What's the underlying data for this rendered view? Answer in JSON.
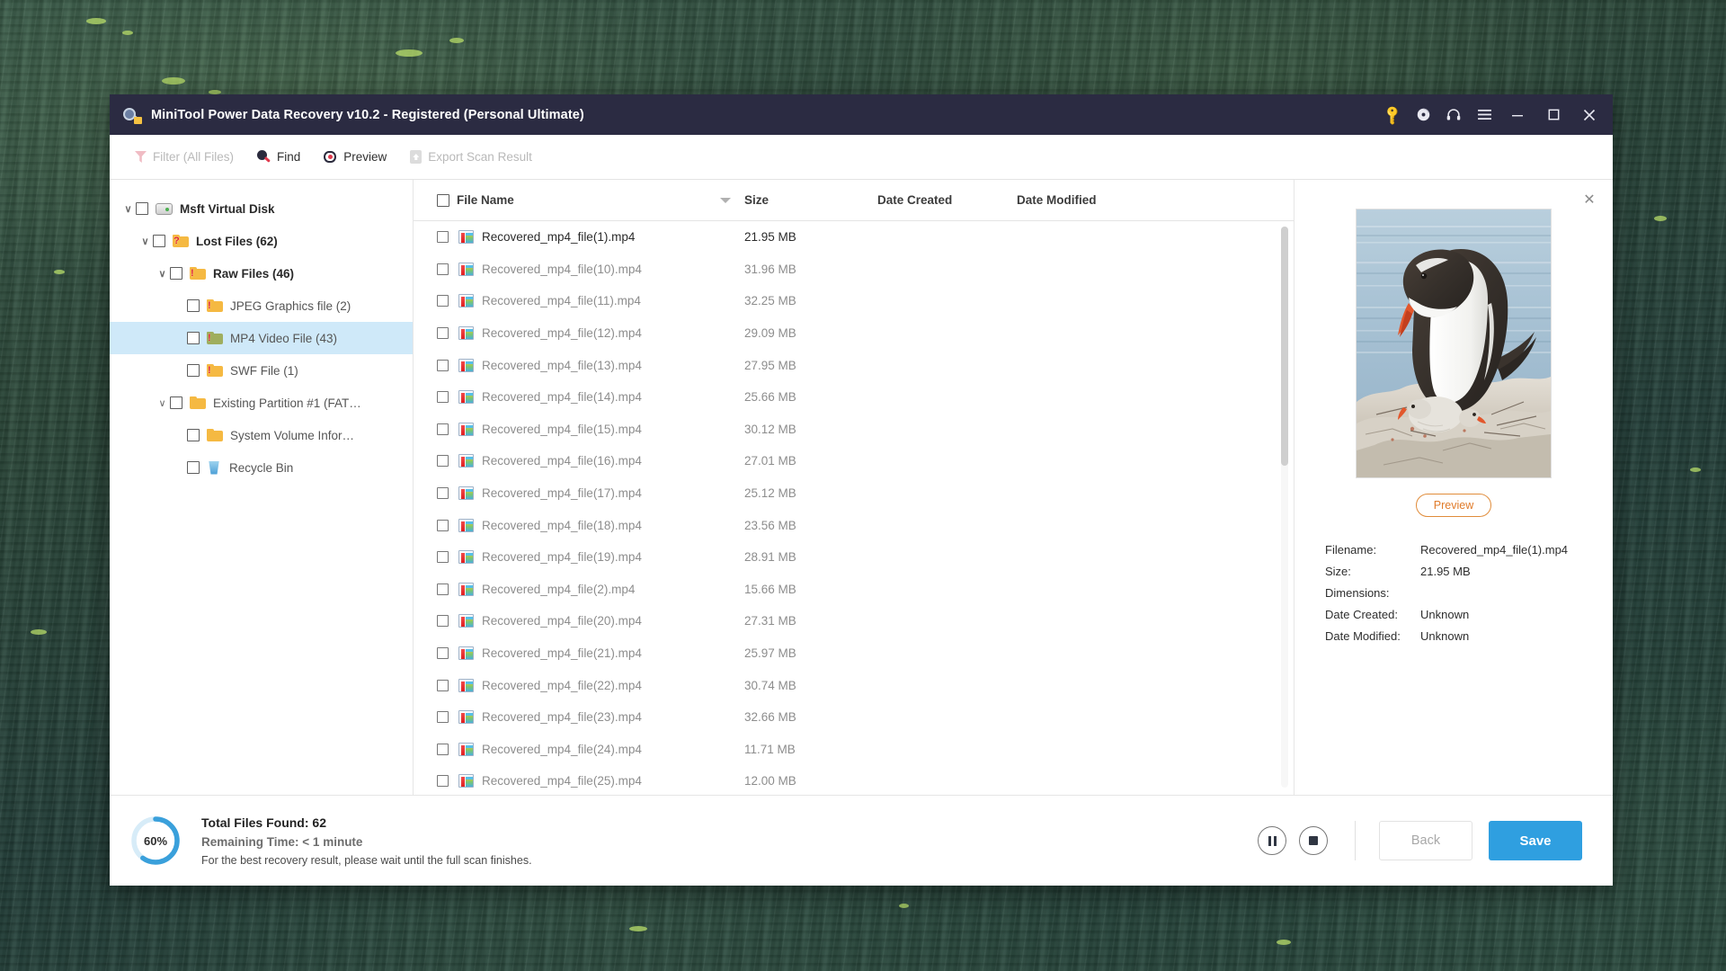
{
  "window": {
    "title": "MiniTool Power Data Recovery v10.2 - Registered (Personal Ultimate)",
    "icons": {
      "key": "key-icon",
      "disc": "disc-icon",
      "headset": "headset-icon",
      "menu": "hamburger-menu-icon",
      "minimize": "minimize-icon",
      "maximize": "maximize-icon",
      "close": "close-icon"
    },
    "controls": {
      "minimize": "–",
      "maximize": "☐",
      "close": "✕"
    }
  },
  "toolbar": {
    "filter_label": "Filter (All Files)",
    "find_label": "Find",
    "preview_label": "Preview",
    "export_label": "Export Scan Result"
  },
  "tree": {
    "nodes": [
      {
        "label": "Msft Virtual Disk",
        "indent": 0,
        "chevron": "∨",
        "icon": "disk",
        "bold": true,
        "selected": false
      },
      {
        "label": "Lost Files (62)",
        "indent": 1,
        "chevron": "∨",
        "icon": "folder-question",
        "bold": true,
        "selected": false
      },
      {
        "label": "Raw Files (46)",
        "indent": 2,
        "chevron": "∨",
        "icon": "folder-alert",
        "bold": true,
        "selected": false
      },
      {
        "label": "JPEG Graphics file (2)",
        "indent": 3,
        "chevron": "",
        "icon": "folder-alert",
        "bold": false,
        "selected": false
      },
      {
        "label": "MP4 Video File (43)",
        "indent": 3,
        "chevron": "",
        "icon": "folder-alert-green",
        "bold": false,
        "selected": true
      },
      {
        "label": "SWF File (1)",
        "indent": 3,
        "chevron": "",
        "icon": "folder-alert",
        "bold": false,
        "selected": false
      },
      {
        "label": "Existing Partition #1 (FAT…",
        "indent": 2,
        "chevron": "∨",
        "icon": "folder",
        "bold": false,
        "selected": false
      },
      {
        "label": "System Volume Infor…",
        "indent": 3,
        "chevron": "",
        "icon": "folder",
        "bold": false,
        "selected": false
      },
      {
        "label": "Recycle Bin",
        "indent": 3,
        "chevron": "",
        "icon": "recycle-bin",
        "bold": false,
        "selected": false
      }
    ]
  },
  "filelist": {
    "columns": {
      "name": "File Name",
      "size": "Size",
      "date_created": "Date Created",
      "date_modified": "Date Modified"
    },
    "sort_indicator": "descending",
    "rows": [
      {
        "name": "Recovered_mp4_file(1).mp4",
        "size": "21.95 MB",
        "active": true
      },
      {
        "name": "Recovered_mp4_file(10).mp4",
        "size": "31.96 MB",
        "active": false
      },
      {
        "name": "Recovered_mp4_file(11).mp4",
        "size": "32.25 MB",
        "active": false
      },
      {
        "name": "Recovered_mp4_file(12).mp4",
        "size": "29.09 MB",
        "active": false
      },
      {
        "name": "Recovered_mp4_file(13).mp4",
        "size": "27.95 MB",
        "active": false
      },
      {
        "name": "Recovered_mp4_file(14).mp4",
        "size": "25.66 MB",
        "active": false
      },
      {
        "name": "Recovered_mp4_file(15).mp4",
        "size": "30.12 MB",
        "active": false
      },
      {
        "name": "Recovered_mp4_file(16).mp4",
        "size": "27.01 MB",
        "active": false
      },
      {
        "name": "Recovered_mp4_file(17).mp4",
        "size": "25.12 MB",
        "active": false
      },
      {
        "name": "Recovered_mp4_file(18).mp4",
        "size": "23.56 MB",
        "active": false
      },
      {
        "name": "Recovered_mp4_file(19).mp4",
        "size": "28.91 MB",
        "active": false
      },
      {
        "name": "Recovered_mp4_file(2).mp4",
        "size": "15.66 MB",
        "active": false
      },
      {
        "name": "Recovered_mp4_file(20).mp4",
        "size": "27.31 MB",
        "active": false
      },
      {
        "name": "Recovered_mp4_file(21).mp4",
        "size": "25.97 MB",
        "active": false
      },
      {
        "name": "Recovered_mp4_file(22).mp4",
        "size": "30.74 MB",
        "active": false
      },
      {
        "name": "Recovered_mp4_file(23).mp4",
        "size": "32.66 MB",
        "active": false
      },
      {
        "name": "Recovered_mp4_file(24).mp4",
        "size": "11.71 MB",
        "active": false
      },
      {
        "name": "Recovered_mp4_file(25).mp4",
        "size": "12.00 MB",
        "active": false
      }
    ]
  },
  "preview": {
    "close_glyph": "✕",
    "image_alt": "gentoo-penguin-with-chick-on-rocky-nest",
    "preview_button": "Preview",
    "fields": [
      {
        "key": "Filename:",
        "value": "Recovered_mp4_file(1).mp4"
      },
      {
        "key": "Size:",
        "value": "21.95 MB"
      },
      {
        "key": "Dimensions:",
        "value": ""
      },
      {
        "key": "Date Created:",
        "value": "Unknown"
      },
      {
        "key": "Date Modified:",
        "value": "Unknown"
      }
    ]
  },
  "status": {
    "progress_percent": "60%",
    "progress_value": 60,
    "total_files_label": "Total Files Found:",
    "total_files_value": "62",
    "remaining_label": "Remaining Time:",
    "remaining_value": "< 1 minute",
    "hint": "For the best recovery result, please wait until the full scan finishes.",
    "pause_label": "pause-button",
    "stop_label": "stop-button",
    "back_label": "Back",
    "save_label": "Save"
  },
  "colors": {
    "titlebar": "#2b2b42",
    "accent_blue": "#2f9fe0",
    "selection_blue": "#cfe9f9",
    "preview_orange": "#e07b2a",
    "folder_yellow": "#f5b942",
    "alert_red": "#e0202f"
  }
}
